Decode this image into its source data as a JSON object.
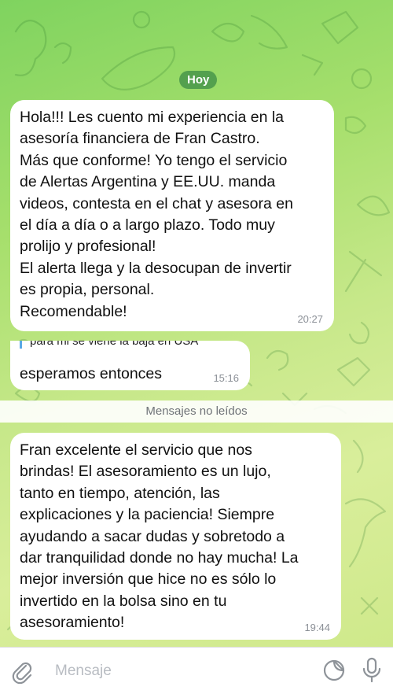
{
  "chat": {
    "date_label": "Hoy",
    "unread_label": "Mensajes no leídos",
    "messages": [
      {
        "text": "Hola!!! Les cuento mi experiencia en la\nasesoría financiera de Fran Castro.\nMás que conforme! Yo tengo el servicio\nde Alertas Argentina y EE.UU.   manda\nvideos, contesta en el chat y asesora en\nel día a día o a largo plazo. Todo muy\nprolijo y profesional!\nEl alerta llega y la desocupan de invertir\nes propia, personal.\nRecomendable!",
        "time": "20:27"
      },
      {
        "quote": "para mi se viene la baja en USA",
        "text": "esperamos entonces",
        "time": "15:16"
      },
      {
        "text": "Fran excelente el servicio que nos\nbrindas! El asesoramiento es un lujo,\ntanto en tiempo, atención, las\nexplicaciones y la paciencia! Siempre\nayudando a sacar dudas y sobretodo a\ndar tranquilidad donde no hay mucha! La\nmejor inversión que hice no es sólo lo\ninvertido en la bolsa sino en tu\nasesoramiento!",
        "time": "19:44"
      }
    ]
  },
  "input": {
    "placeholder": "Mensaje",
    "attach_icon": "paperclip-icon",
    "sticker_icon": "sticker-icon",
    "mic_icon": "microphone-icon"
  },
  "colors": {
    "bg_start": "#7fd35f",
    "bg_end": "#d9ee9b",
    "bubble": "#ffffff",
    "time_text": "#8a8f96",
    "quote_bar": "#5aa9e6",
    "date_pill": "#3c8c46"
  }
}
